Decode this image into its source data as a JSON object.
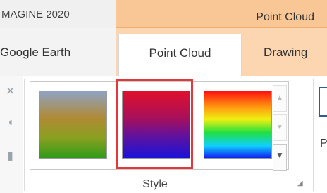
{
  "header": {
    "app_title": "MAGINE 2020",
    "context_title": "Point Cloud"
  },
  "tabs": [
    {
      "label": "Google Earth",
      "active": false
    },
    {
      "label": "Point Cloud",
      "active": true
    },
    {
      "label": "Drawing",
      "active": false
    }
  ],
  "gallery": {
    "items": [
      {
        "name": "elevation-gradient",
        "colors": [
          "#8fa3c5",
          "#b08a35",
          "#2f9b1a"
        ]
      },
      {
        "name": "red-blue-gradient",
        "colors": [
          "#e0102c",
          "#5a12a4",
          "#1a12d8"
        ],
        "selected": true
      },
      {
        "name": "rainbow-gradient",
        "colors": [
          "#ff1010",
          "#f0f010",
          "#20e040",
          "#10d0ff",
          "#1020f0"
        ]
      }
    ],
    "group_label": "Style"
  },
  "right_group": {
    "partial_label": "P"
  },
  "colors": {
    "context_orange": "#f9c796",
    "tab_row_orange": "#fbd6b0",
    "selection_red": "#e5363b"
  }
}
